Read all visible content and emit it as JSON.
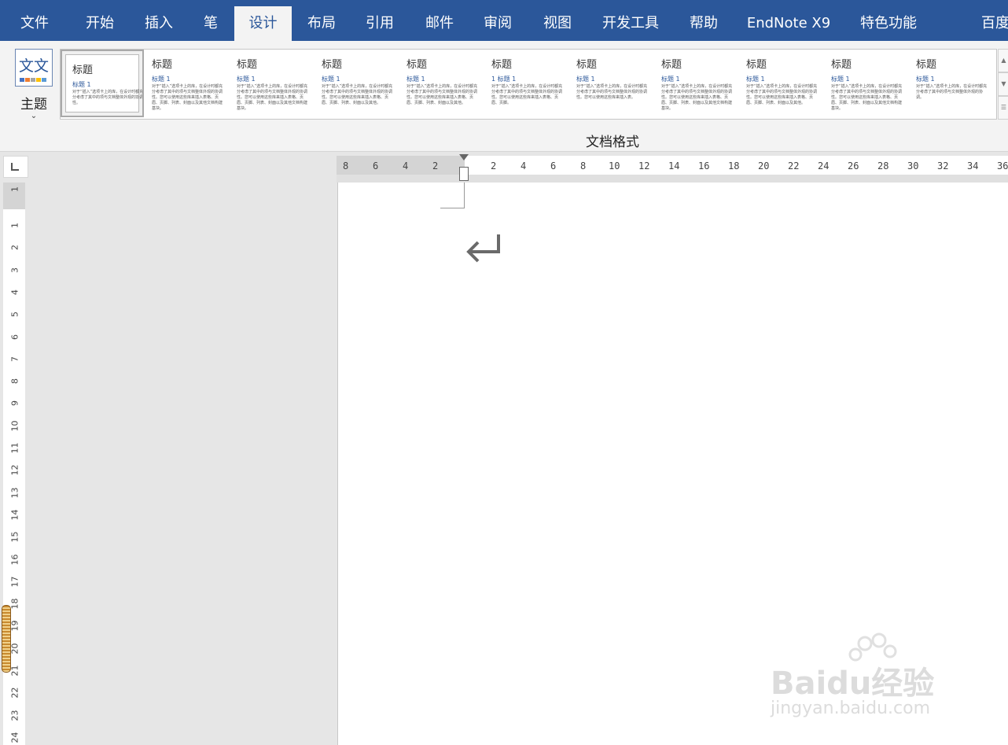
{
  "tabs": [
    "文件",
    "开始",
    "插入",
    "笔",
    "设计",
    "布局",
    "引用",
    "邮件",
    "审阅",
    "视图",
    "开发工具",
    "帮助",
    "EndNote X9",
    "特色功能",
    "百度"
  ],
  "active_tab": "设计",
  "theme": {
    "icon_text": "文文",
    "label": "主题",
    "chevron": "⌄"
  },
  "style_gallery": {
    "styles": [
      {
        "title": "标题",
        "heading": "标题 1",
        "body": "对于“插入”选项卡上的库，在设计时都充分考虑了其中的项与文档整体外观的协调性。"
      },
      {
        "title": "标题",
        "heading": "标题 1",
        "body": "对于“插入”选项卡上的库，在设计时都充分考虑了其中的项与文档整体外观的协调性。您可以使用这些库来插入表格、页眉、页脚、列表、封面以及其他文档构建基块。"
      },
      {
        "title": "标题",
        "heading": "标题 1",
        "body": "对于“插入”选项卡上的库，在设计时都充分考虑了其中的项与文档整体外观的协调性。您可以使用这些库来插入表格、页眉、页脚、列表、封面以及其他文档构建基块。"
      },
      {
        "title": "标题",
        "heading": "标题 1",
        "body": "对于“插入”选项卡上的库，在设计时都充分考虑了其中的项与文档整体外观的协调性。您可以使用这些库来插入表格、页眉、页脚、列表、封面以及其他。"
      },
      {
        "title": "标题",
        "heading": "标题 1",
        "body": "对于“插入”选项卡上的库，在设计时都充分考虑了其中的项与文档整体外观的协调性。您可以使用这些库来插入表格、页眉、页脚、列表、封面以及其他。"
      },
      {
        "title": "标题",
        "heading": "1 标题 1",
        "body": "对于“插入”选项卡上的库，在设计时都充分考虑了其中的项与文档整体外观的协调性。您可以使用这些库来插入表格、页眉、页脚。"
      },
      {
        "title": "标题",
        "heading": "标题 1",
        "body": "对于“插入”选项卡上的库，在设计时都充分考虑了其中的项与文档整体外观的协调性。您可以使用这些库来插入表。"
      },
      {
        "title": "标题",
        "heading": "标题 1",
        "body": "对于“插入”选项卡上的库，在设计时都充分考虑了其中的项与文档整体外观的协调性。您可以使用这些库来插入表格、页眉、页脚、列表、封面以及其他文档构建基块。"
      },
      {
        "title": "标题",
        "heading": "标题 1",
        "body": "对于“插入”选项卡上的库，在设计时都充分考虑了其中的项与文档整体外观的协调性。您可以使用这些库来插入表格、页眉、页脚、列表、封面以及其他。"
      },
      {
        "title": "标题",
        "heading": "标题 1",
        "body": "对于“插入”选项卡上的库，在设计时都充分考虑了其中的项与文档整体外观的协调性。您可以使用这些库来插入表格、页眉、页脚、列表、封面以及其他文档构建基块。"
      },
      {
        "title": "标题",
        "heading": "标题 1",
        "body": "对于“插入”选项卡上的库，在设计时都充分考虑了其中的项与文档整体外观的协调。"
      }
    ],
    "selected_index": 0
  },
  "group_label": "文档格式",
  "hruler_labels": [
    "8",
    "6",
    "4",
    "2",
    "2",
    "4",
    "6",
    "8",
    "10",
    "12",
    "14",
    "16",
    "18",
    "20",
    "22",
    "24",
    "26",
    "28",
    "30",
    "32",
    "34",
    "36"
  ],
  "vruler_labels": [
    "1",
    "1",
    "2",
    "3",
    "4",
    "5",
    "6",
    "7",
    "8",
    "9",
    "10",
    "11",
    "12",
    "13",
    "14",
    "15",
    "16",
    "17",
    "18",
    "19",
    "20",
    "21",
    "22",
    "23",
    "24"
  ],
  "paragraph_mark": "↵",
  "watermark": {
    "text": "Baidu经验",
    "url": "jingyan.baidu.com"
  },
  "colors": {
    "tabbar": "#2b579a",
    "ribbon": "#f3f3f3",
    "canvas": "#e6e6e6"
  }
}
